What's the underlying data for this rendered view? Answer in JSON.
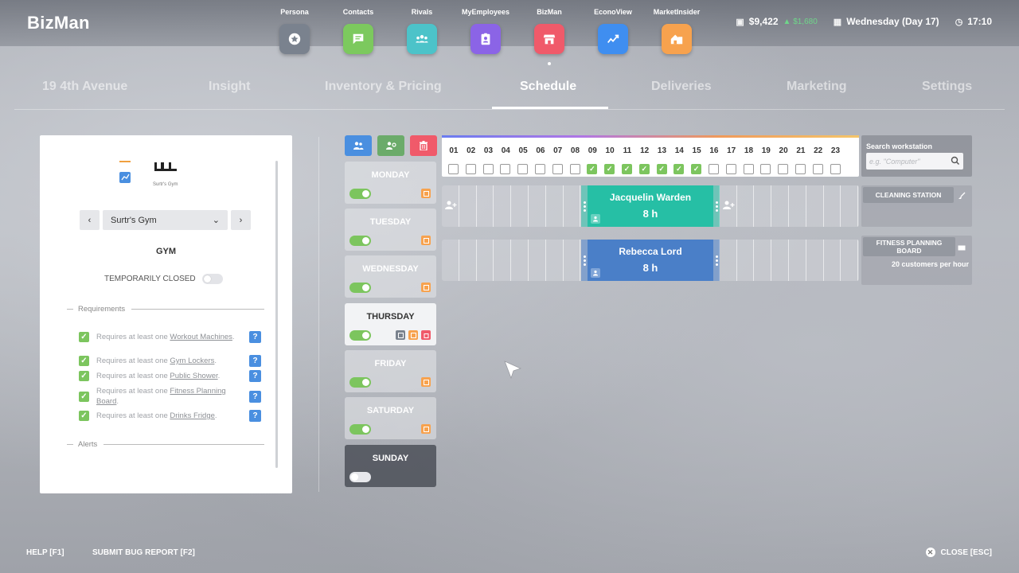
{
  "brand": "BizMan",
  "apps": [
    {
      "label": "Persona",
      "color": "#7a828e",
      "icon": "star-icon"
    },
    {
      "label": "Contacts",
      "color": "#7cc95e",
      "icon": "chat-icon"
    },
    {
      "label": "Rivals",
      "color": "#4cc3c9",
      "icon": "people-icon"
    },
    {
      "label": "MyEmployees",
      "color": "#8b64e6",
      "icon": "badge-icon"
    },
    {
      "label": "BizMan",
      "color": "#f05a6a",
      "icon": "store-icon"
    },
    {
      "label": "EconoView",
      "color": "#3f8ef0",
      "icon": "trend-icon"
    },
    {
      "label": "MarketInsider",
      "color": "#f7a24e",
      "icon": "house-icon"
    }
  ],
  "status": {
    "money": "$9,422",
    "money_delta": "$1,680",
    "date": "Wednesday (Day 17)",
    "time": "17:10"
  },
  "tabs": [
    {
      "label": "19 4th Avenue"
    },
    {
      "label": "Insight"
    },
    {
      "label": "Inventory & Pricing"
    },
    {
      "label": "Schedule"
    },
    {
      "label": "Deliveries"
    },
    {
      "label": "Marketing"
    },
    {
      "label": "Settings"
    }
  ],
  "active_tab": "Schedule",
  "business": {
    "logo_caption": "Surtr's Gym",
    "selected": "Surtr's Gym",
    "type": "GYM",
    "temporarily_closed_label": "TEMPORARILY CLOSED",
    "requirements_title": "Requirements",
    "alerts_title": "Alerts",
    "requirements": [
      {
        "prefix": "Requires at least one ",
        "item": "Workout Machines",
        "suffix": "."
      },
      {
        "prefix": "Requires at least one ",
        "item": "Gym Lockers",
        "suffix": "."
      },
      {
        "prefix": "Requires at least one ",
        "item": "Public Shower",
        "suffix": "."
      },
      {
        "prefix": "Requires at least one ",
        "item": "Fitness Planning Board",
        "suffix": "."
      },
      {
        "prefix": "Requires at least one ",
        "item": "Drinks Fridge",
        "suffix": "."
      }
    ]
  },
  "days": [
    {
      "name": "MONDAY",
      "enabled": true
    },
    {
      "name": "TUESDAY",
      "enabled": true
    },
    {
      "name": "WEDNESDAY",
      "enabled": true
    },
    {
      "name": "THURSDAY",
      "enabled": true,
      "active": true
    },
    {
      "name": "FRIDAY",
      "enabled": true
    },
    {
      "name": "SATURDAY",
      "enabled": true
    },
    {
      "name": "SUNDAY",
      "enabled": false
    }
  ],
  "hours": [
    "01",
    "02",
    "03",
    "04",
    "05",
    "06",
    "07",
    "08",
    "09",
    "10",
    "11",
    "12",
    "13",
    "14",
    "15",
    "16",
    "17",
    "18",
    "19",
    "20",
    "21",
    "22",
    "23"
  ],
  "hours_checked": [
    "09",
    "10",
    "11",
    "12",
    "13",
    "14",
    "15"
  ],
  "search": {
    "label": "Search workstation",
    "placeholder": "e.g. \"Computer\""
  },
  "shifts": [
    {
      "employee": "Jacquelin Warden",
      "hours": "8 h",
      "color": "#26bfa5",
      "workstation": "CLEANING STATION",
      "workstation_sub": ""
    },
    {
      "employee": "Rebecca Lord",
      "hours": "8 h",
      "color": "#4a7fc8",
      "workstation": "FITNESS PLANNING BOARD",
      "workstation_sub": "20 customers per hour"
    }
  ],
  "footer": {
    "help": "HELP [F1]",
    "bug": "SUBMIT BUG REPORT [F2]",
    "close": "CLOSE [ESC]"
  }
}
